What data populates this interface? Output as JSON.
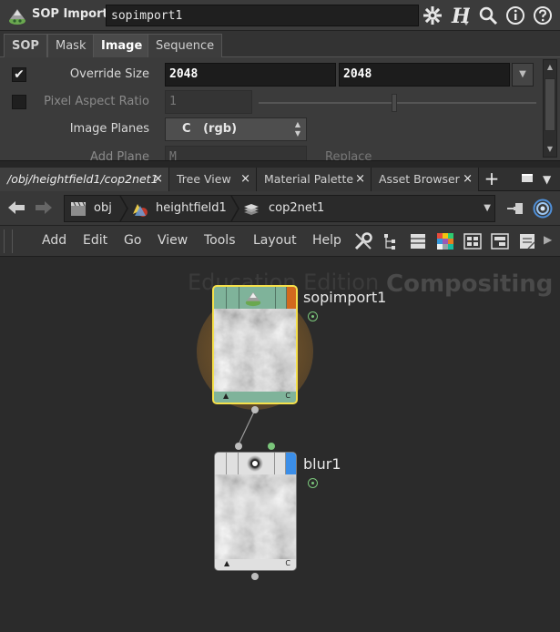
{
  "header": {
    "node_type": "SOP Import",
    "node_name": "sopimport1"
  },
  "tabs": [
    {
      "label": "SOP"
    },
    {
      "label": "Mask"
    },
    {
      "label": "Image"
    },
    {
      "label": "Sequence"
    }
  ],
  "params": {
    "override_size": {
      "label": "Override Size",
      "checked": "✔",
      "x": "2048",
      "y": "2048"
    },
    "pixel_aspect": {
      "label": "Pixel Aspect Ratio",
      "value": "1"
    },
    "image_planes": {
      "label": "Image Planes",
      "value": "C   (rgb)"
    },
    "add_plane": {
      "label": "Add Plane",
      "value": "M",
      "replace": "Replace"
    }
  },
  "pane_tabs": [
    {
      "label": "/obj/heightfield1/cop2net1"
    },
    {
      "label": "Tree View"
    },
    {
      "label": "Material Palette"
    },
    {
      "label": "Asset Browser"
    }
  ],
  "pane_tab_close": "×",
  "path": {
    "crumbs": [
      {
        "label": "obj"
      },
      {
        "label": "heightfield1"
      },
      {
        "label": "cop2net1"
      }
    ]
  },
  "menu": {
    "items": [
      "Add",
      "Edit",
      "Go",
      "View",
      "Tools",
      "Layout",
      "Help"
    ]
  },
  "network": {
    "watermark_edition": "Education Edition",
    "watermark_context": "Compositing",
    "nodes": [
      {
        "name": "sopimport1",
        "footer_left": "▲",
        "footer_right": "C"
      },
      {
        "name": "blur1",
        "footer_left": "▲",
        "footer_right": "C"
      }
    ]
  },
  "colors": {
    "sopimport_header": "#7fb39a",
    "sopimport_flag": "#d2691e",
    "blur_flag": "#3b8ee8",
    "selected_outline": "#f5e04a",
    "glow": "#9c7030"
  }
}
